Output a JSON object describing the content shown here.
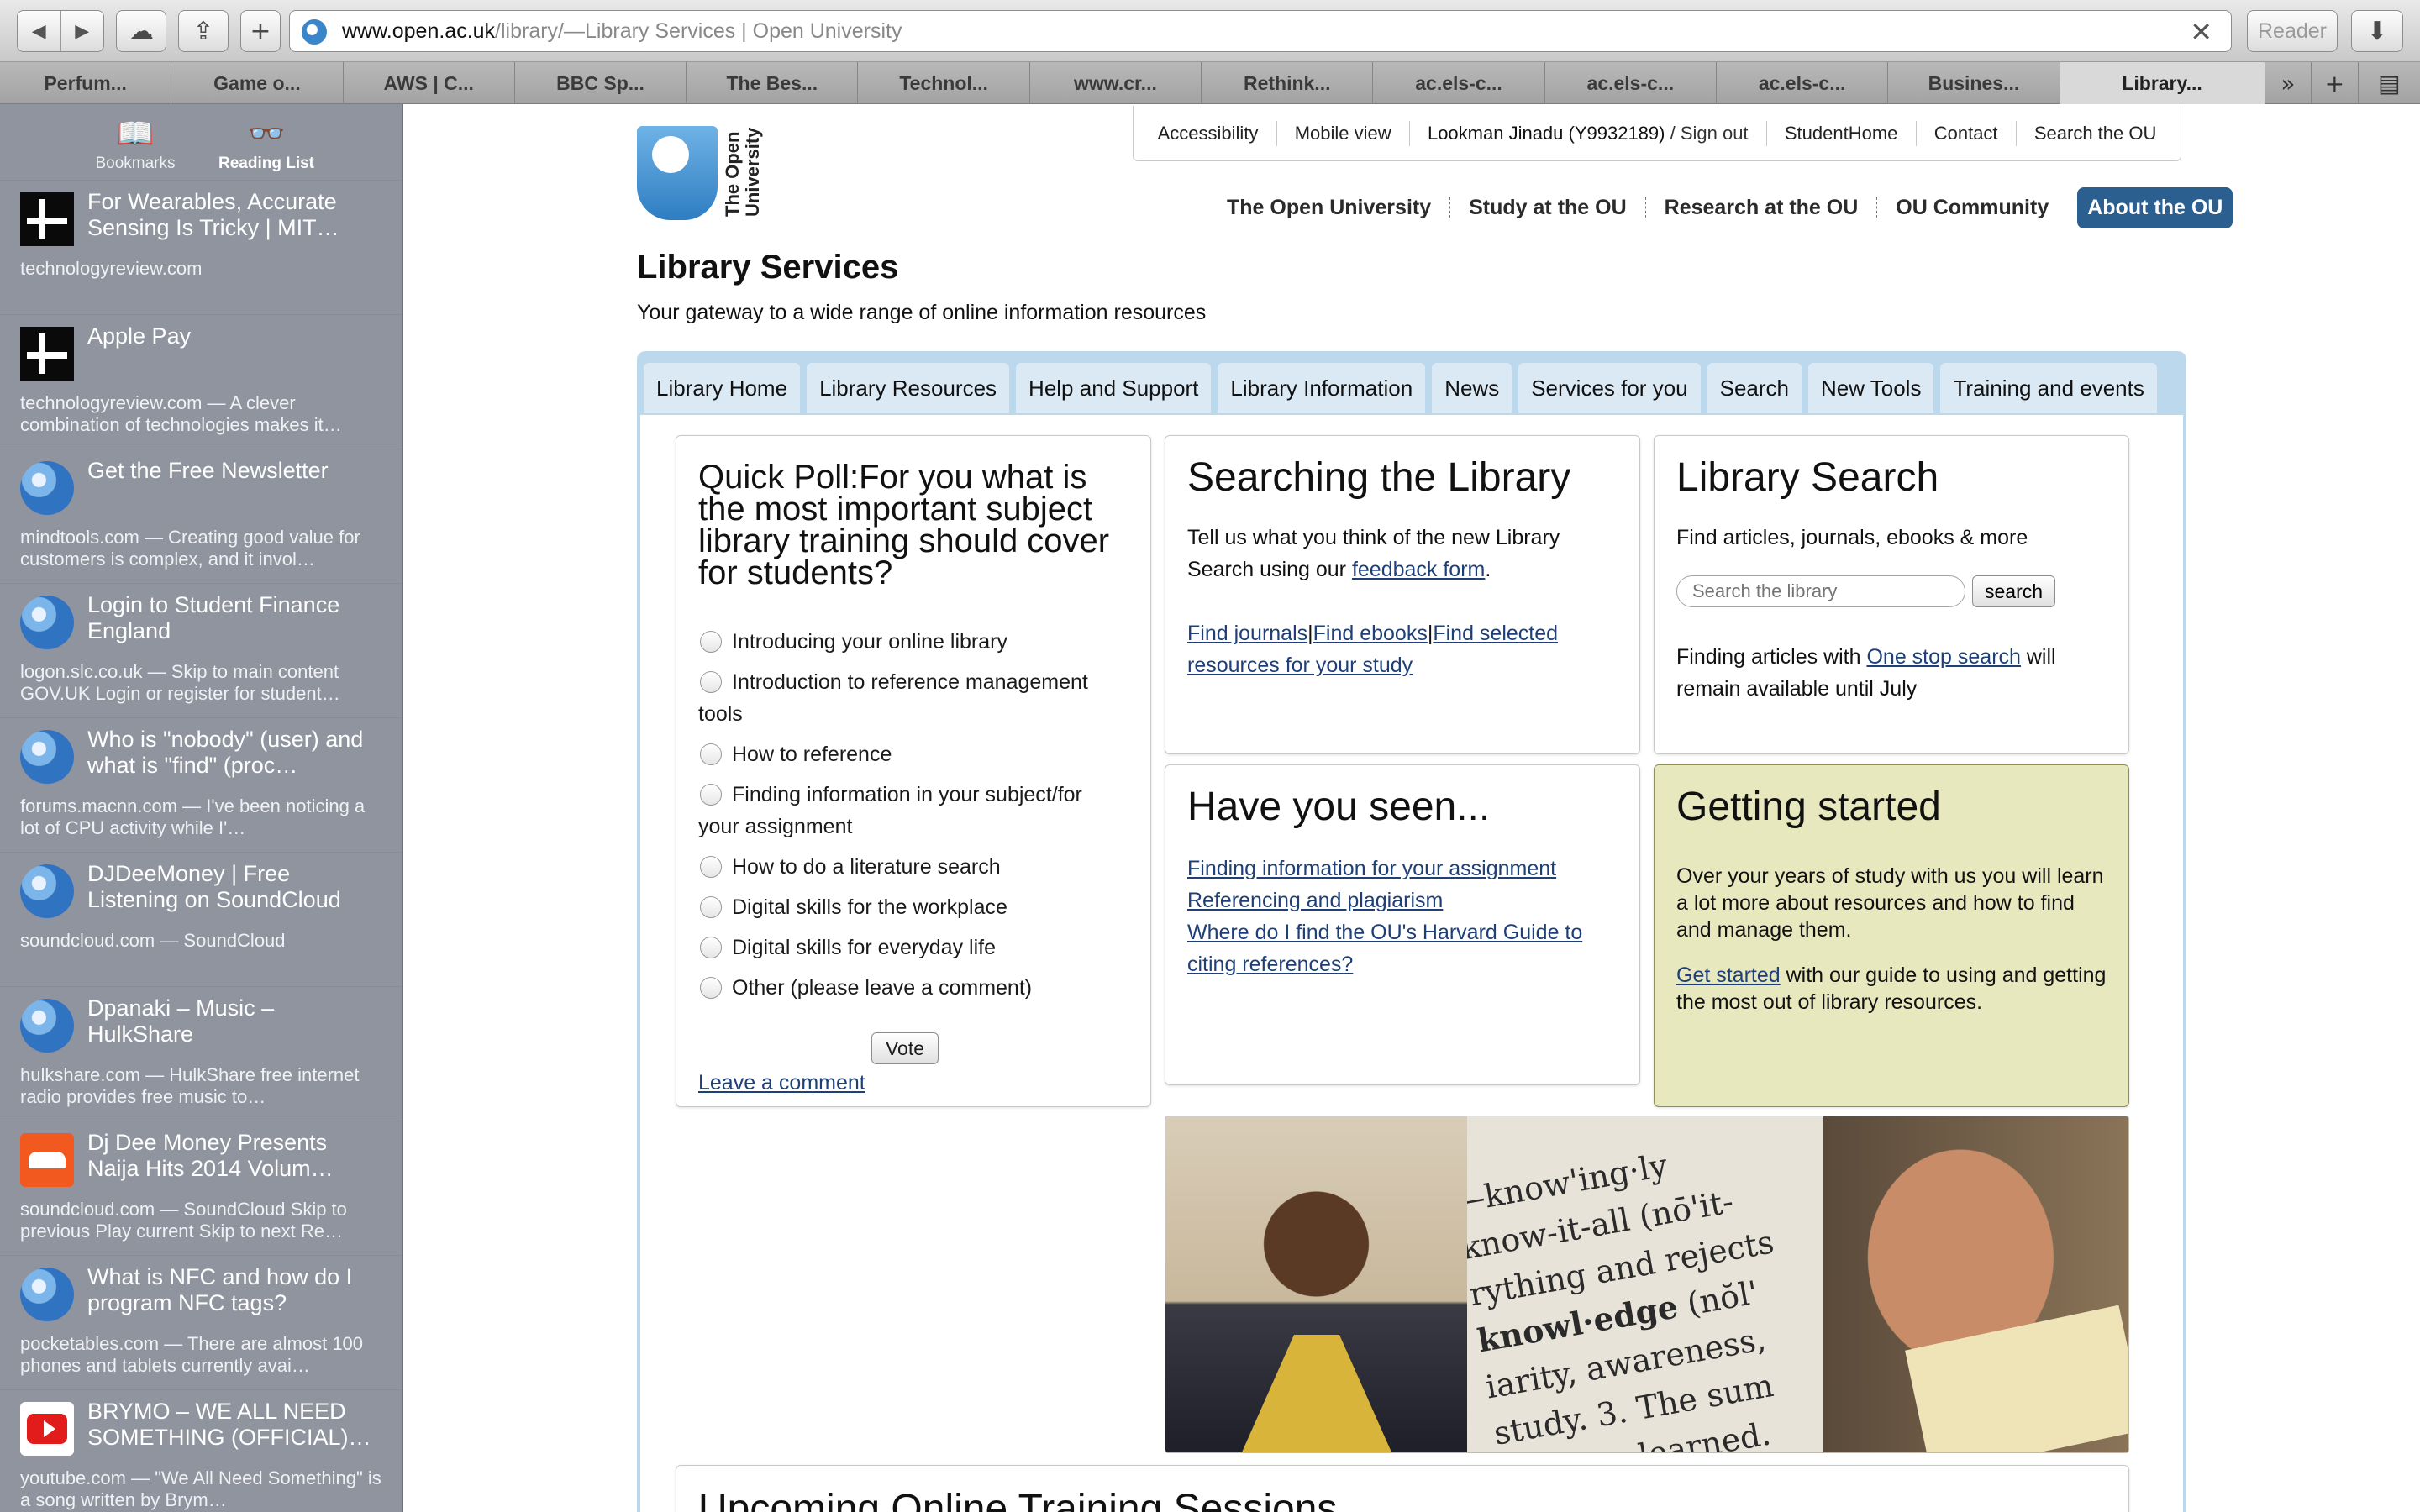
{
  "browser": {
    "url_host": "www.open.ac.uk",
    "url_path": "/library/",
    "url_separator": " — ",
    "page_title": "Library Services | Open University",
    "reader_label": "Reader",
    "tabs": [
      "Perfum...",
      "Game o...",
      "AWS | C...",
      "BBC Sp...",
      "The Bes...",
      "Technol...",
      "www.cr...",
      "Rethink...",
      "ac.els-c...",
      "ac.els-c...",
      "ac.els-c...",
      "Busines...",
      "Library..."
    ]
  },
  "sidebar": {
    "modes": [
      {
        "label": "Bookmarks",
        "icon": "book-icon"
      },
      {
        "label": "Reading List",
        "icon": "glasses-icon"
      }
    ],
    "items": [
      {
        "title": "For Wearables, Accurate Sensing Is Tricky | MIT…",
        "desc": "technologyreview.com",
        "icon": "tr"
      },
      {
        "title": "Apple Pay",
        "desc": "technologyreview.com — A clever combination of technologies makes it…",
        "icon": "tr"
      },
      {
        "title": "Get the Free Newsletter",
        "desc": "mindtools.com — Creating good value for customers is complex, and it invol…",
        "icon": "globe"
      },
      {
        "title": "Login to Student Finance England",
        "desc": "logon.slc.co.uk — Skip to main content GOV.UK Login or register for student…",
        "icon": "globe"
      },
      {
        "title": "Who is \"nobody\" (user) and what is \"find\" (proc…",
        "desc": "forums.macnn.com — I've been noticing a lot of CPU activity while I'…",
        "icon": "globe"
      },
      {
        "title": "DJDeeMoney | Free Listening on SoundCloud",
        "desc": "soundcloud.com — SoundCloud",
        "icon": "globe"
      },
      {
        "title": "Dpanaki – Music – HulkShare",
        "desc": "hulkshare.com — HulkShare free internet radio provides free music to…",
        "icon": "globe"
      },
      {
        "title": "Dj Dee Money Presents Naija Hits 2014 Volum…",
        "desc": "soundcloud.com — SoundCloud Skip to previous Play current Skip to next Re…",
        "icon": "sc"
      },
      {
        "title": "What is NFC and how do I program NFC tags?",
        "desc": "pocketables.com — There are almost 100 phones and tablets currently avai…",
        "icon": "globe"
      },
      {
        "title": "BRYMO – WE ALL NEED SOMETHING (OFFICIAL)…",
        "desc": "youtube.com — \"We All Need Something\" is a song written by Brym…",
        "icon": "yt"
      }
    ]
  },
  "ou": {
    "logo_text": "The Open University",
    "util_nav": {
      "accessibility": "Accessibility",
      "mobile": "Mobile view",
      "user": "Lookman Jinadu (Y9932189)",
      "signout": " / Sign out",
      "studenthome": "StudentHome",
      "contact": "Contact",
      "search": "Search the OU"
    },
    "main_nav": [
      "The Open University",
      "Study at the OU",
      "Research at the OU",
      "OU Community",
      "About the OU"
    ],
    "title": "Library Services",
    "subtitle": "Your gateway to a wide range of online information resources",
    "lib_tabs": [
      "Library Home",
      "Library Resources",
      "Help and Support",
      "Library Information",
      "News",
      "Services for you",
      "Search",
      "New Tools",
      "Training and events"
    ]
  },
  "poll": {
    "title": "Quick Poll:For you what is the most important subject library training should cover for students?",
    "options": [
      "Introducing your online library",
      "Introduction to reference management tools",
      "How to reference",
      "Finding information in your subject/for your assignment",
      "How to do a literature search",
      "Digital skills for the workplace",
      "Digital skills for everyday life",
      "Other (please leave a comment)"
    ],
    "vote": "Vote",
    "comment": "Leave a comment"
  },
  "searching": {
    "title": "Searching the Library",
    "text_before": "Tell us what you think of the new Library Search using our ",
    "feedback_link": "feedback form",
    "text_after": ".",
    "link_journals": "Find journals",
    "link_ebooks": "Find ebooks",
    "link_selected": "Find selected resources for your study",
    "pipe": "|"
  },
  "library_search": {
    "title": "Library Search",
    "desc": "Find articles, journals, ebooks & more",
    "placeholder": "Search the library",
    "button": "search",
    "text_before": "Finding articles with ",
    "link": "One stop search",
    "text_after": " will remain available until July"
  },
  "seen": {
    "title": "Have you seen...",
    "links": [
      "Finding information for your assignment",
      "Referencing and plagiarism",
      "Where do I find the OU's Harvard Guide to citing references?"
    ]
  },
  "started": {
    "title": "Getting started",
    "p1": "Over your years of study with us you will learn a lot more about resources and how to find and manage them.",
    "link": "Get started",
    "p2_after": " with our guide to using and getting the most out of library resources."
  },
  "upcoming": {
    "title": "Upcoming Online Training Sessions"
  },
  "colors": {
    "nav_active": "#2a5f8f",
    "lib_nav_bg": "#bcd8ec",
    "getting_started_bg": "#e7e8be",
    "link": "#1e3f77",
    "sidebar_bg": "#8f949e"
  }
}
